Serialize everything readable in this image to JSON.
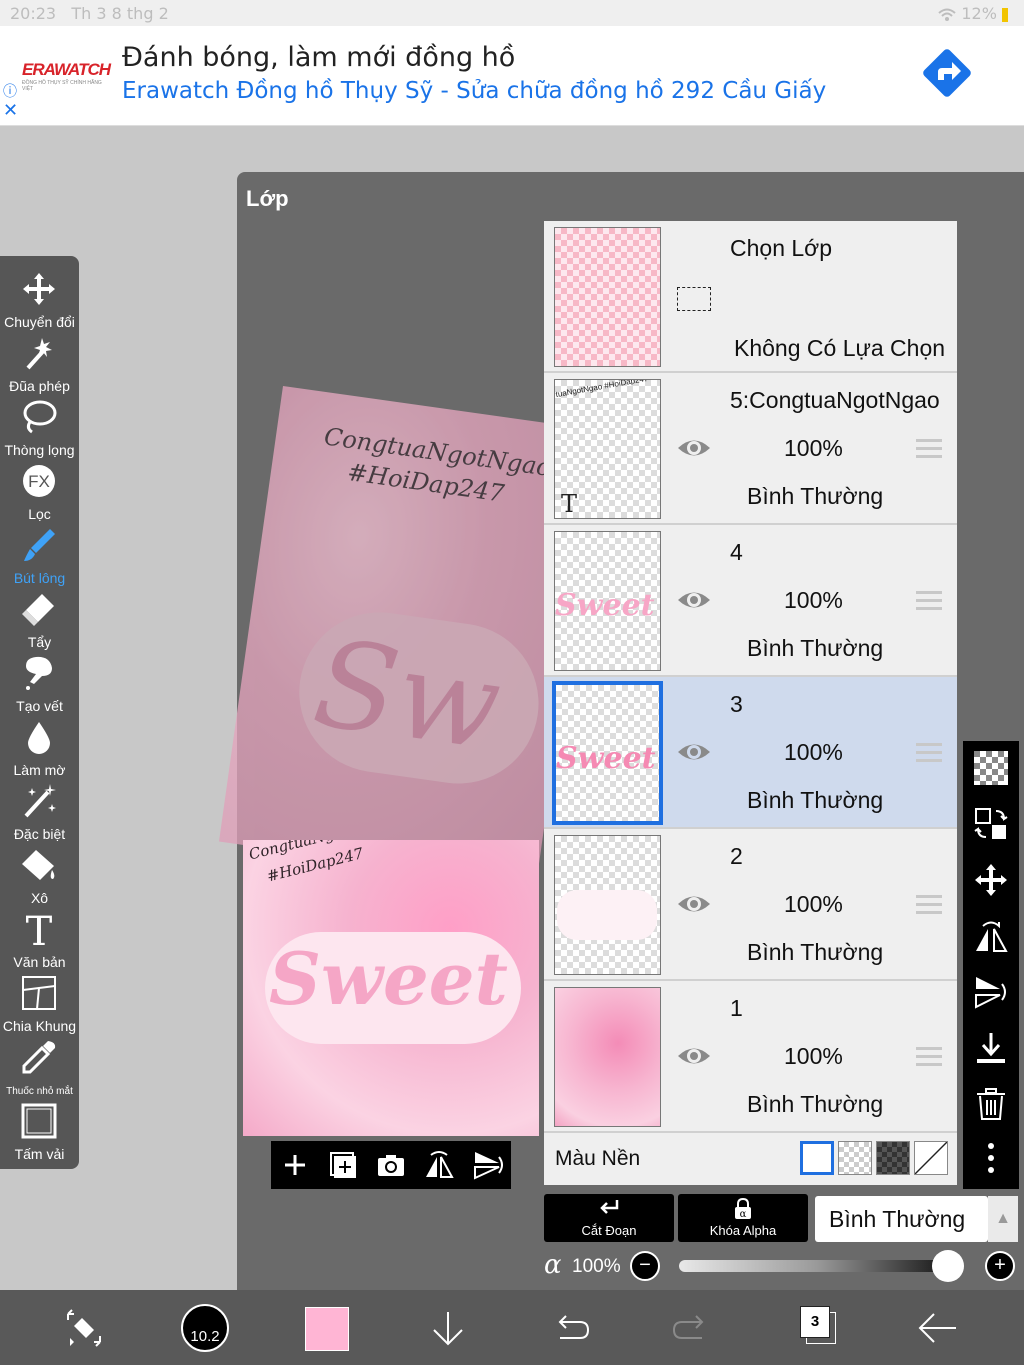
{
  "status": {
    "time": "20:23",
    "date": "Th 3 8 thg 2",
    "battery": "12%"
  },
  "ad": {
    "brand": "ERAWATCH",
    "brand_tag": "ĐỒNG HỒ THỤY SỸ CHÍNH HÃNG VIỆT",
    "title": "Đánh bóng, làm mới đồng hồ",
    "subtitle": "Erawatch Đồng hồ Thụy Sỹ - Sửa chữa đồng hồ 292 Cầu Giấy",
    "info_icon": "info-icon",
    "close_icon": "close-icon"
  },
  "tools": [
    {
      "label": "Chuyển đổi",
      "icon": "move-icon"
    },
    {
      "label": "Đũa phép",
      "icon": "magic-wand-icon"
    },
    {
      "label": "Thòng lọng",
      "icon": "lasso-icon"
    },
    {
      "label": "Lọc",
      "icon": "fx-icon",
      "glyph": "FX"
    },
    {
      "label": "Bút lông",
      "icon": "brush-icon",
      "active": true
    },
    {
      "label": "Tẩy",
      "icon": "eraser-icon"
    },
    {
      "label": "Tạo vết",
      "icon": "smudge-icon"
    },
    {
      "label": "Làm mờ",
      "icon": "blur-icon"
    },
    {
      "label": "Đặc biệt",
      "icon": "special-icon"
    },
    {
      "label": "Xô",
      "icon": "bucket-icon"
    },
    {
      "label": "Văn bản",
      "icon": "text-icon",
      "glyph": "T"
    },
    {
      "label": "Chia Khung",
      "icon": "frame-divider-icon"
    },
    {
      "label": "Thuốc nhỏ mắt",
      "icon": "eyedropper-icon"
    },
    {
      "label": "Tấm vải",
      "icon": "canvas-icon"
    }
  ],
  "panel": {
    "title": "Lớp"
  },
  "canvas": {
    "watermark_line1": "CongtuaNgotNgao",
    "watermark_line2": "#HoiDap247",
    "art_text": "Sweet",
    "art_text_partial": "Sw"
  },
  "selection": {
    "title": "Chọn Lớp",
    "status": "Không Có Lựa Chọn"
  },
  "layers": [
    {
      "name": "5:CongtuaNgotNgao",
      "opacity": "100%",
      "blend": "Bình Thường",
      "type": "text",
      "glyph": "T",
      "selected": false,
      "mini_text": "tuaNgotNgao #HoiDap247"
    },
    {
      "name": "4",
      "opacity": "100%",
      "blend": "Bình Thường",
      "type": "sweet",
      "mini_text": "Sweet",
      "selected": false
    },
    {
      "name": "3",
      "opacity": "100%",
      "blend": "Bình Thường",
      "type": "sweet",
      "mini_text": "Sweet",
      "selected": true
    },
    {
      "name": "2",
      "opacity": "100%",
      "blend": "Bình Thường",
      "type": "blob",
      "selected": false
    },
    {
      "name": "1",
      "opacity": "100%",
      "blend": "Bình Thường",
      "type": "bg",
      "selected": false
    }
  ],
  "background_row": {
    "label": "Màu Nền"
  },
  "bottom_controls": {
    "clip_label": "Cắt Đoạn",
    "alpha_lock_label": "Khóa Alpha",
    "blend_mode": "Bình Thường",
    "alpha_symbol": "α",
    "opacity": "100%",
    "opacity_fraction": 1.0,
    "minus": "−",
    "plus": "+"
  },
  "bottombar": {
    "brush_size": "10.2",
    "color": "#ffb5d4",
    "layer_count": "3"
  },
  "colors": {
    "accent": "#3fa2f7",
    "selected_row": "#cfdaed",
    "selection_border": "#1f6fe0"
  }
}
